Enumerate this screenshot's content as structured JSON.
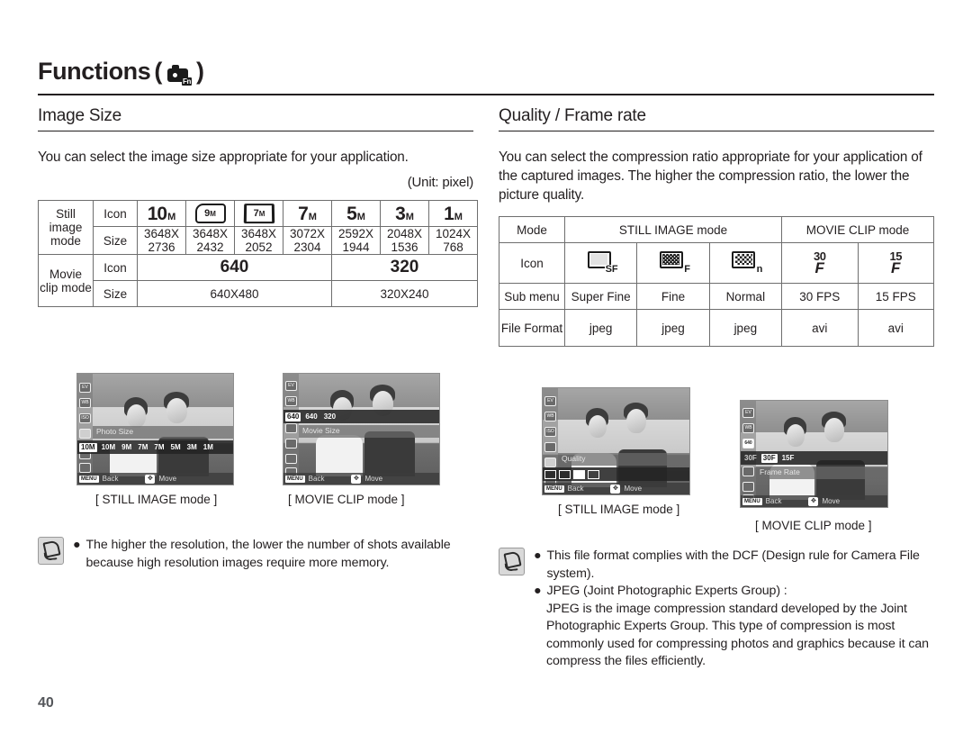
{
  "header": {
    "title": "Functions",
    "paren_open": "(",
    "paren_close": ")",
    "icon_label": "Fn",
    "icon_name": "camera-fn-icon"
  },
  "page_number": "40",
  "left_column": {
    "section_title": "Image Size",
    "intro": "You can select the image size appropriate for your application.",
    "unit_note": "(Unit: pixel)",
    "table": {
      "still_label": "Still image mode",
      "movie_label": "Movie clip mode",
      "row_icon_label": "Icon",
      "row_size_label": "Size",
      "still_icons": [
        {
          "num": "10",
          "suffix": "M",
          "style": "plain"
        },
        {
          "num": "9",
          "suffix": "M",
          "style": "fold"
        },
        {
          "num": "7",
          "suffix": "M",
          "style": "wide"
        },
        {
          "num": "7",
          "suffix": "M",
          "style": "plain"
        },
        {
          "num": "5",
          "suffix": "M",
          "style": "plain"
        },
        {
          "num": "3",
          "suffix": "M",
          "style": "plain"
        },
        {
          "num": "1",
          "suffix": "M",
          "style": "plain"
        }
      ],
      "still_sizes": [
        {
          "w": "3648X",
          "h": "2736"
        },
        {
          "w": "3648X",
          "h": "2432"
        },
        {
          "w": "3648X",
          "h": "2052"
        },
        {
          "w": "3072X",
          "h": "2304"
        },
        {
          "w": "2592X",
          "h": "1944"
        },
        {
          "w": "2048X",
          "h": "1536"
        },
        {
          "w": "1024X",
          "h": "768"
        }
      ],
      "movie_icons": [
        "640",
        "320"
      ],
      "movie_sizes": [
        "640X480",
        "320X240"
      ]
    },
    "shots": [
      {
        "caption": "[ STILL IMAGE mode ]",
        "menu_label": "Photo Size",
        "options": [
          "10M",
          "10M",
          "9M",
          "7M",
          "7M",
          "5M",
          "3M",
          "1M"
        ],
        "selected_index": 0,
        "back_label": "Back",
        "move_label": "Move",
        "menu_button": "MENU"
      },
      {
        "caption": "[ MOVIE CLIP mode ]",
        "menu_label": "Movie Size",
        "options": [
          "640",
          "640",
          "320"
        ],
        "selected_index": 0,
        "back_label": "Back",
        "move_label": "Move",
        "menu_button": "MENU"
      }
    ],
    "note": {
      "bullets": [
        "The higher the resolution, the lower the number of shots available because high resolution images require more memory."
      ]
    }
  },
  "right_column": {
    "section_title": "Quality / Frame rate",
    "intro": "You can select the compression ratio appropriate for your application of the captured images. The higher the compression ratio, the lower the picture quality.",
    "table": {
      "mode_label": "Mode",
      "icon_label": "Icon",
      "submenu_label": "Sub menu",
      "fileformat_label": "File Format",
      "mode_groups": [
        "STILL IMAGE mode",
        "MOVIE CLIP mode"
      ],
      "icons": [
        {
          "type": "quality",
          "tag": "SF",
          "density": "sf"
        },
        {
          "type": "quality",
          "tag": "F",
          "density": "f"
        },
        {
          "type": "quality",
          "tag": "n",
          "density": "n"
        },
        {
          "type": "fps",
          "num": "30",
          "glyph": "F"
        },
        {
          "type": "fps",
          "num": "15",
          "glyph": "F"
        }
      ],
      "submenus": [
        "Super Fine",
        "Fine",
        "Normal",
        "30 FPS",
        "15 FPS"
      ],
      "formats": [
        "jpeg",
        "jpeg",
        "jpeg",
        "avi",
        "avi"
      ]
    },
    "shots": [
      {
        "caption": "[ STILL IMAGE mode ]",
        "menu_label": "Quality",
        "options": [
          "SF",
          "F",
          "n",
          "grid"
        ],
        "selected_index": 2,
        "back_label": "Back",
        "move_label": "Move",
        "menu_button": "MENU"
      },
      {
        "caption": "[ MOVIE CLIP mode ]",
        "menu_label": "Frame Rate",
        "options": [
          "30F",
          "30F",
          "15F"
        ],
        "selected_index": 1,
        "back_label": "Back",
        "move_label": "Move",
        "menu_button": "MENU"
      }
    ],
    "note": {
      "bullets": [
        "This file format complies with the DCF (Design rule for Camera File system).",
        "JPEG (Joint Photographic Experts Group) :"
      ],
      "continuation": "JPEG is the image compression standard developed by the Joint Photographic Experts Group. This type of compression is most commonly used for compressing photos and graphics because it can compress the files efficiently."
    }
  },
  "colors": {
    "header_cell": "#d2d2d2",
    "text": "#231f20",
    "rule": "#231f20"
  }
}
